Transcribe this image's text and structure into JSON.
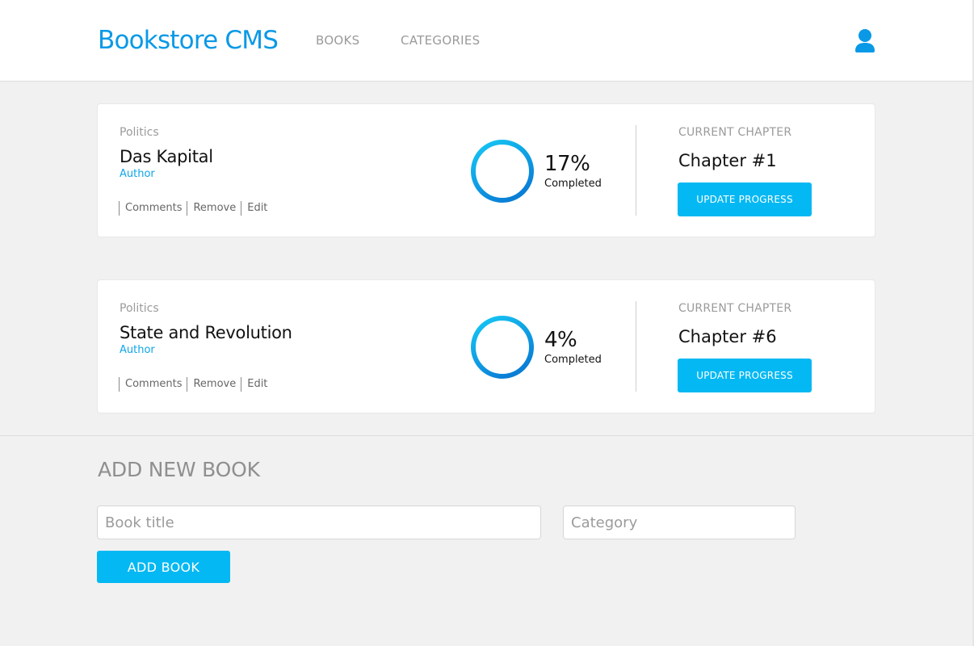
{
  "header": {
    "brand": "Bookstore CMS",
    "nav": [
      {
        "label": "BOOKS"
      },
      {
        "label": "CATEGORIES"
      }
    ],
    "user_icon": "user-icon"
  },
  "books": [
    {
      "genre": "Politics",
      "title": "Das Kapital",
      "author": "Author",
      "actions": [
        "Comments",
        "Remove",
        "Edit"
      ],
      "progress": 0.17,
      "percent_text": "17%",
      "completed_label": "Completed",
      "current_chapter_label": "CURRENT CHAPTER",
      "chapter": "Chapter #1",
      "update_label": "UPDATE PROGRESS"
    },
    {
      "genre": "Politics",
      "title": "State and Revolution",
      "author": "Author",
      "actions": [
        "Comments",
        "Remove",
        "Edit"
      ],
      "progress": 0.04,
      "percent_text": "4%",
      "completed_label": "Completed",
      "current_chapter_label": "CURRENT CHAPTER",
      "chapter": "Chapter #6",
      "update_label": "UPDATE PROGRESS"
    }
  ],
  "add_form": {
    "heading": "ADD NEW BOOK",
    "title_placeholder": "Book title",
    "category_placeholder": "Category",
    "submit_label": "ADD BOOK"
  },
  "colors": {
    "brand": "#0a99e6",
    "accent": "#04b8f3",
    "ring_start": "#16c9f5",
    "ring_end": "#0a7fd6",
    "background": "#f1f1f1"
  }
}
